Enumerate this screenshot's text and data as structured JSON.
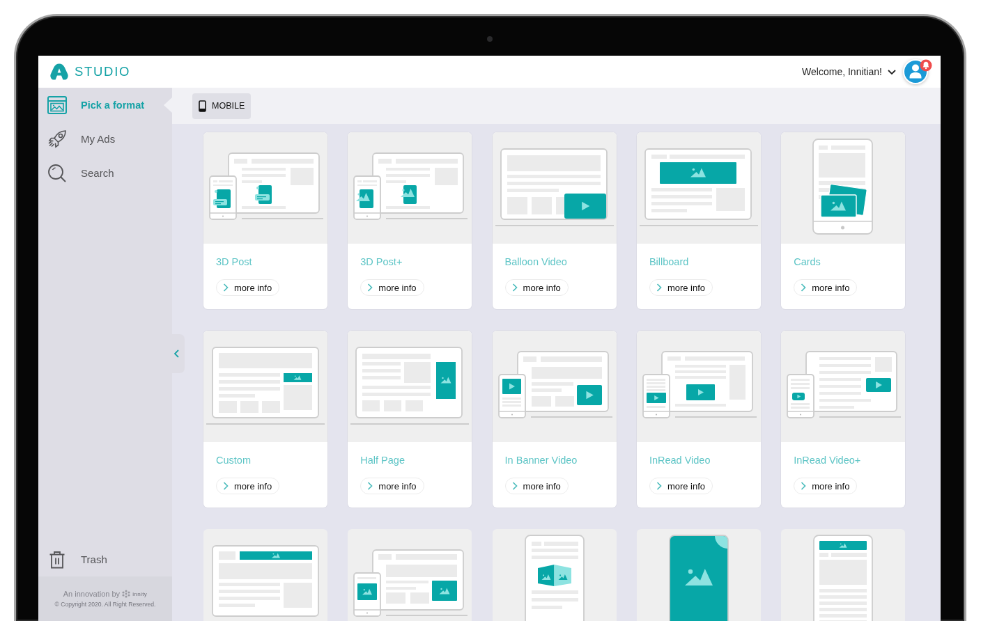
{
  "header": {
    "brand": "STUDIO",
    "greeting": "Welcome, Innitian!",
    "notification": true
  },
  "sidebar": {
    "items": [
      {
        "label": "Pick a format",
        "selected": true
      },
      {
        "label": "My Ads",
        "selected": false
      },
      {
        "label": "Search",
        "selected": false
      }
    ],
    "bottom_items": [
      {
        "label": "Trash",
        "selected": false
      }
    ],
    "footer": {
      "credit": "An innovation by",
      "brand": "innity",
      "copyright": "© Copyright 2020. All Right Reserved."
    }
  },
  "toolbar": {
    "device_button": "MOBILE"
  },
  "formats": [
    {
      "kind": "post",
      "title": "3D Post",
      "link": "more info"
    },
    {
      "kind": "postplus",
      "title": "3D Post+",
      "link": "more info"
    },
    {
      "kind": "balloon",
      "title": "Balloon Video",
      "link": "more info"
    },
    {
      "kind": "billboard",
      "title": "Billboard",
      "link": "more info"
    },
    {
      "kind": "cards",
      "title": "Cards",
      "link": "more info"
    },
    {
      "kind": "custom",
      "title": "Custom",
      "link": "more info"
    },
    {
      "kind": "halfpage",
      "title": "Half Page",
      "link": "more info"
    },
    {
      "kind": "inbanner",
      "title": "In Banner Video",
      "link": "more info"
    },
    {
      "kind": "inread",
      "title": "InRead Video",
      "link": "more info"
    },
    {
      "kind": "inreadplus",
      "title": "InRead Video+",
      "link": "more info"
    },
    {
      "kind": "topbanner"
    },
    {
      "kind": "devices"
    },
    {
      "kind": "cube"
    },
    {
      "kind": "fullscreen"
    },
    {
      "kind": "scroller"
    }
  ]
}
